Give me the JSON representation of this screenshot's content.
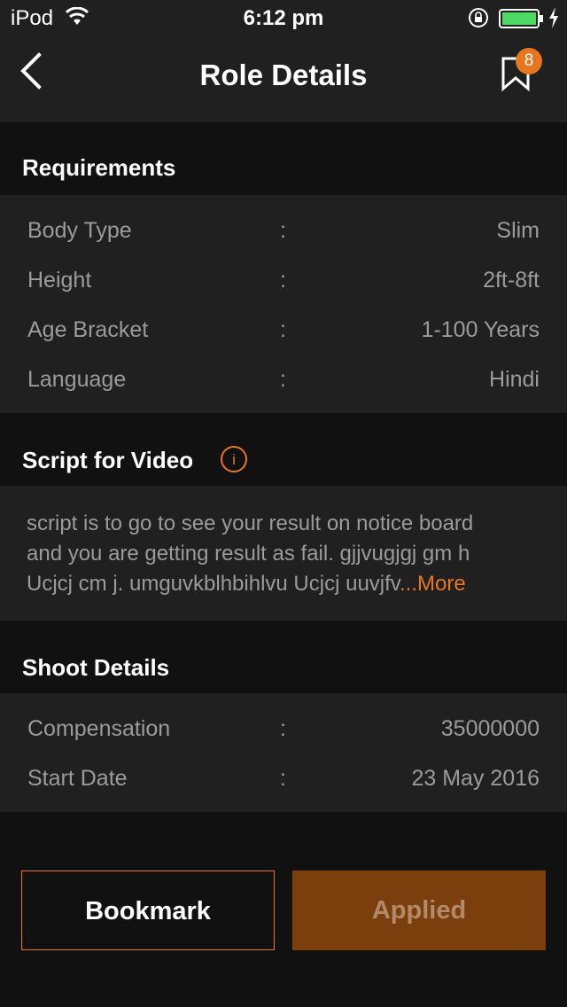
{
  "status_bar": {
    "carrier": "iPod",
    "time": "6:12 pm"
  },
  "nav": {
    "title": "Role Details",
    "bookmark_count": "8"
  },
  "requirements": {
    "title": "Requirements",
    "rows": [
      {
        "label": "Body Type",
        "sep": ":",
        "value": "Slim"
      },
      {
        "label": "Height",
        "sep": ":",
        "value": "2ft-8ft"
      },
      {
        "label": "Age Bracket",
        "sep": ":",
        "value": "1-100 Years"
      },
      {
        "label": "Language",
        "sep": ":",
        "value": "Hindi"
      }
    ]
  },
  "script": {
    "title": "Script for Video",
    "info_glyph": "i",
    "lines": [
      "script is to go to see your result on notice board",
      "and you are getting result as fail. gjjvugjgj gm h",
      "Ucjcj cm j. umguvkblhbihlvu Ucjcj uuvjfv"
    ],
    "more_label": "...More"
  },
  "shoot": {
    "title": "Shoot Details",
    "rows": [
      {
        "label": "Compensation",
        "sep": ":",
        "value": "35000000"
      },
      {
        "label": "Start Date",
        "sep": ":",
        "value": "23 May 2016"
      }
    ]
  },
  "actions": {
    "bookmark_label": "Bookmark",
    "applied_label": "Applied"
  },
  "colors": {
    "accent": "#e8761e",
    "applied_bg": "#7a3f0c",
    "panel_bg": "#202020",
    "header_bg": "#111111",
    "battery": "#4cd964"
  }
}
